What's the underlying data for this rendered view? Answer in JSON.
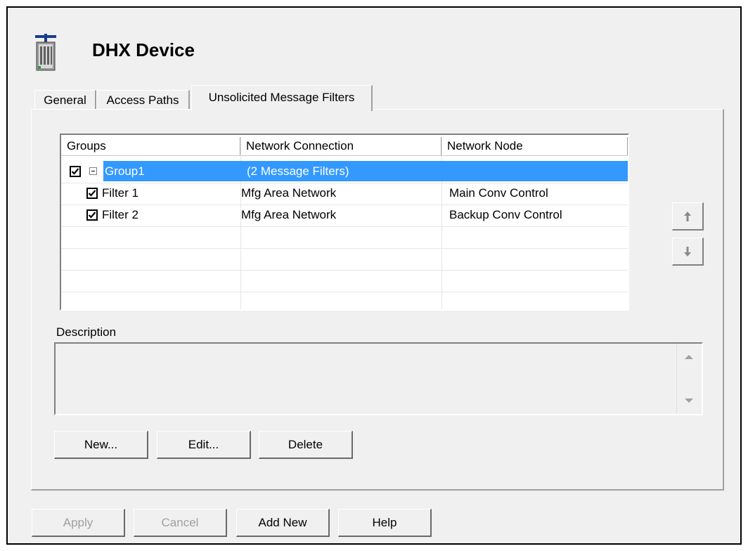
{
  "dialog": {
    "title": "DHX Device",
    "icon": "device-rack-icon"
  },
  "tabs": [
    {
      "label": "General",
      "active": false
    },
    {
      "label": "Access Paths",
      "active": false
    },
    {
      "label": "Unsolicited Message Filters",
      "active": true
    }
  ],
  "list": {
    "columns": [
      "Groups",
      "Network Connection",
      "Network Node"
    ],
    "rows": [
      {
        "name": "Group1",
        "connection": "(2 Message Filters)",
        "node": "",
        "checked": true,
        "expanded": true,
        "selected": true,
        "level": 0
      },
      {
        "name": "Filter 1",
        "connection": "Mfg Area Network",
        "node": "Main Conv Control",
        "checked": true,
        "selected": false,
        "level": 1
      },
      {
        "name": "Filter 2",
        "connection": "Mfg Area Network",
        "node": "Backup Conv Control",
        "checked": true,
        "selected": false,
        "level": 1
      }
    ]
  },
  "description": {
    "label": "Description",
    "value": ""
  },
  "actions": {
    "new": "New...",
    "edit": "Edit...",
    "delete": "Delete"
  },
  "footer": {
    "apply": "Apply",
    "cancel": "Cancel",
    "add_new": "Add New",
    "help": "Help"
  },
  "colors": {
    "selection": "#3399ff",
    "dialog_bg": "#f0f0f0"
  }
}
